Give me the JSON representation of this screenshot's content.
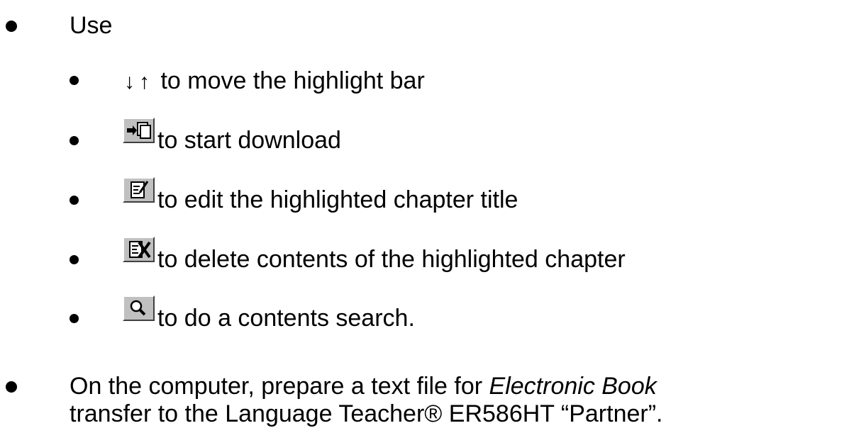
{
  "items": [
    {
      "text": "Use"
    },
    {
      "text": "to move the highlight bar",
      "icons": [
        "down-arrow-icon",
        "up-arrow-icon"
      ],
      "glyphs": [
        "↓",
        "↑"
      ]
    },
    {
      "text": "to start download",
      "icon": "download-icon"
    },
    {
      "text": "to edit the highlighted chapter title",
      "icon": "edit-icon"
    },
    {
      "text": "to delete contents of the highlighted chapter",
      "icon": "delete-icon"
    },
    {
      "text": "to do a contents search.",
      "icon": "search-icon"
    }
  ],
  "last_bullet": {
    "line1_prefix": "On the computer, prepare a text file for ",
    "line1_italic": "Electronic Book",
    "line2": "transfer to the Language Teacher® ER586HT “Partner”."
  }
}
